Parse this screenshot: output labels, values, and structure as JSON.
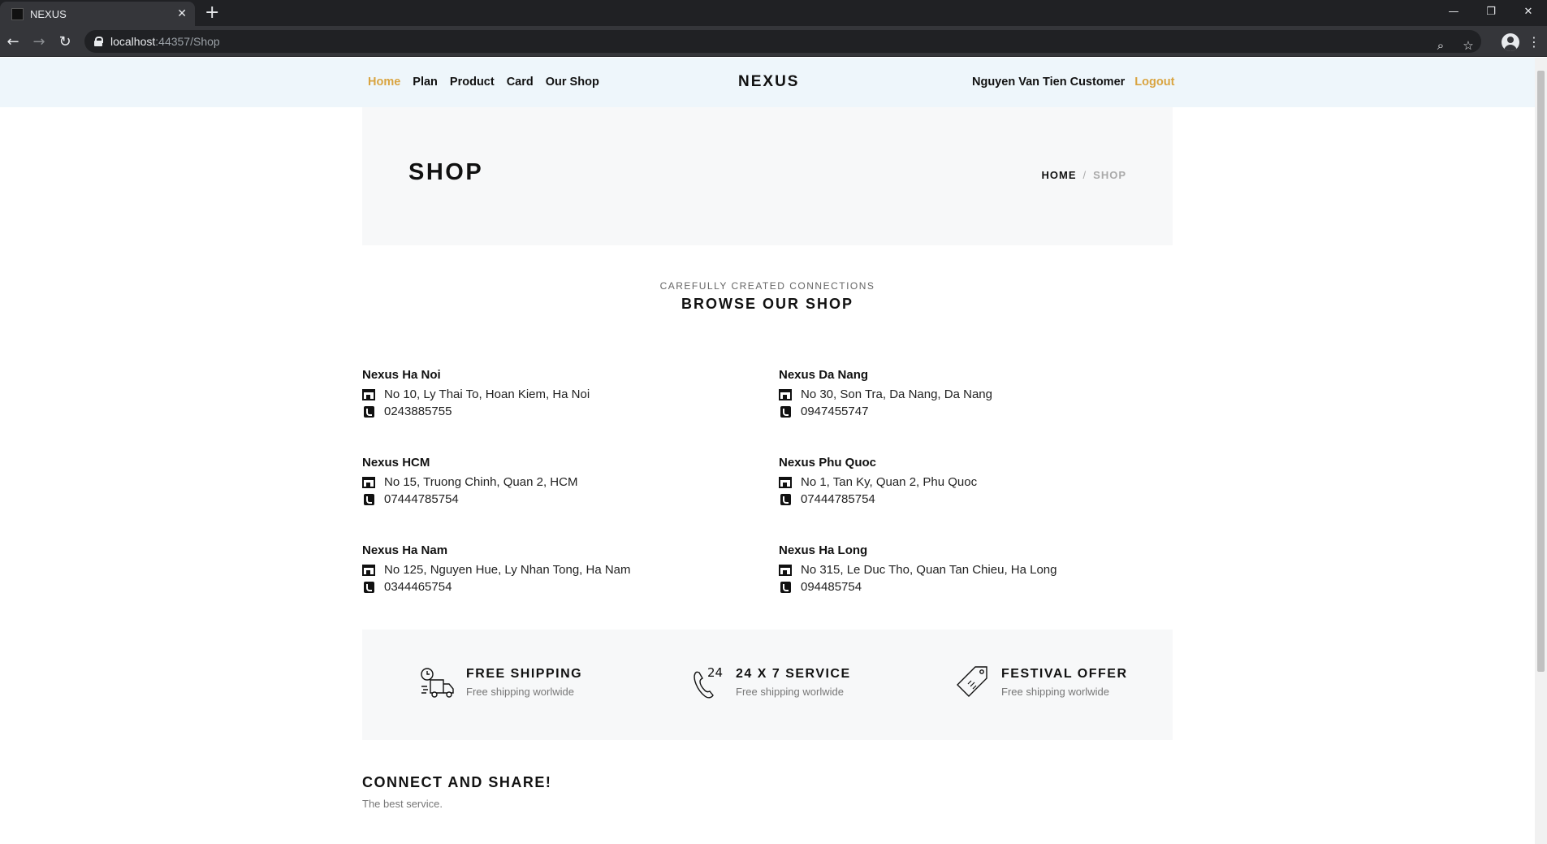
{
  "browser": {
    "tab_title": "NEXUS",
    "tab_close": "✕",
    "new_tab": "+",
    "url_host": "localhost",
    "url_rest": ":44357/Shop",
    "window_controls": {
      "minimize": "—",
      "restore": "❐",
      "close": "✕"
    },
    "nav": {
      "back": "←",
      "forward": "→",
      "reload": "↻"
    },
    "omni": {
      "zoom": "⌕",
      "bookmark": "☆",
      "menu": "⋮"
    }
  },
  "header": {
    "nav_items": [
      {
        "label": "Home",
        "active": true
      },
      {
        "label": "Plan",
        "active": false
      },
      {
        "label": "Product",
        "active": false
      },
      {
        "label": "Card",
        "active": false
      },
      {
        "label": "Our Shop",
        "active": false
      }
    ],
    "brand": "NEXUS",
    "user_name": "Nguyen Van Tien Customer",
    "logout_label": "Logout"
  },
  "hero": {
    "title": "SHOP",
    "breadcrumb_home": "HOME",
    "breadcrumb_sep": "/",
    "breadcrumb_current": "SHOP"
  },
  "section": {
    "kicker": "CAREFULLY CREATED CONNECTIONS",
    "title": "BROWSE OUR SHOP"
  },
  "shops": [
    {
      "name": "Nexus Ha Noi",
      "address": "No 10, Ly Thai To, Hoan Kiem, Ha Noi",
      "phone": "0243885755"
    },
    {
      "name": "Nexus Da Nang",
      "address": "No 30, Son Tra, Da Nang, Da Nang",
      "phone": "0947455747"
    },
    {
      "name": "Nexus HCM",
      "address": "No 15, Truong Chinh, Quan 2, HCM",
      "phone": "07444785754"
    },
    {
      "name": "Nexus Phu Quoc",
      "address": "No 1, Tan Ky, Quan 2, Phu Quoc",
      "phone": "07444785754"
    },
    {
      "name": "Nexus Ha Nam",
      "address": "No 125, Nguyen Hue, Ly Nhan Tong, Ha Nam",
      "phone": "0344465754"
    },
    {
      "name": "Nexus Ha Long",
      "address": "No 315, Le Duc Tho, Quan Tan Chieu, Ha Long",
      "phone": "094485754"
    }
  ],
  "features": [
    {
      "icon": "delivery-truck-icon",
      "title": "FREE SHIPPING",
      "subtitle": "Free shipping worlwide"
    },
    {
      "icon": "phone-24-icon",
      "title": "24 X 7 SERVICE",
      "subtitle": "Free shipping worlwide",
      "icon_text": "24"
    },
    {
      "icon": "price-tag-icon",
      "title": "FESTIVAL OFFER",
      "subtitle": "Free shipping worlwide"
    }
  ],
  "footer": {
    "title": "CONNECT AND SHARE!",
    "subtitle": "The best service."
  },
  "colors": {
    "accent": "#d9a440",
    "header_bg": "#eef6fb",
    "panel_bg": "#f7f8f9"
  }
}
